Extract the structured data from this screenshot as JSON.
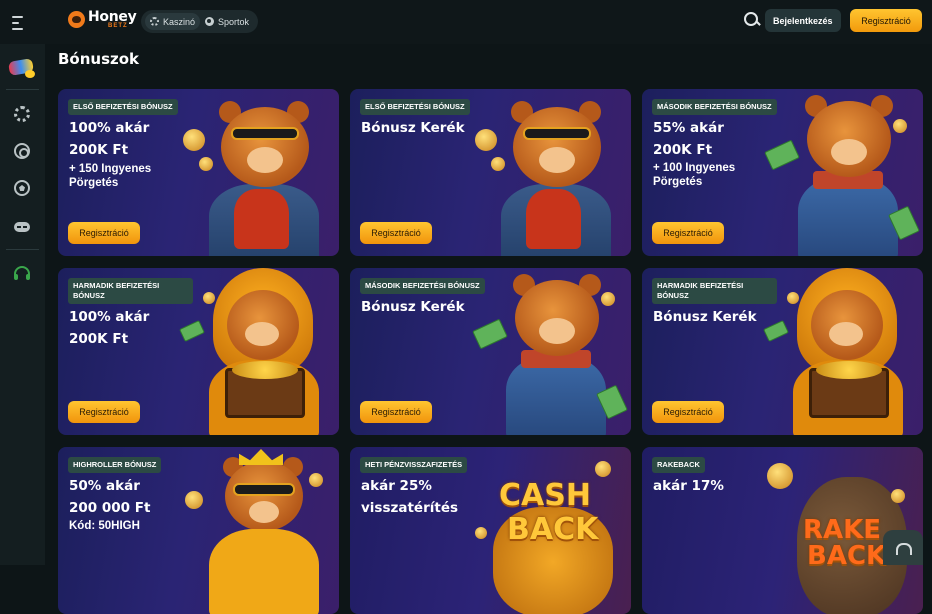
{
  "header": {
    "logo_main": "Honey",
    "logo_sub": "BETZ",
    "modes": [
      {
        "label": "Kaszinó",
        "icon": "chip-icon"
      },
      {
        "label": "Sportok",
        "icon": "ball-icon"
      }
    ],
    "login_label": "Bejelentkezés",
    "register_label": "Regisztráció",
    "accent_color": "#f5a623"
  },
  "sidebar": {
    "items": [
      {
        "icon": "promo-icon"
      },
      {
        "icon": "casino-chip-icon"
      },
      {
        "icon": "live-casino-icon"
      },
      {
        "icon": "sports-ball-icon"
      },
      {
        "icon": "gamepad-icon"
      },
      {
        "icon": "support-headset-icon"
      }
    ]
  },
  "page": {
    "title": "Bónuszok"
  },
  "cards": [
    {
      "badge": "ELSŐ BEFIZETÉSI BÓNUSZ",
      "title": "100% akár\n  200K Ft",
      "sub": "+ 150 Ingyenes Pörgetés",
      "cta": "Regisztráció"
    },
    {
      "badge": "ELSŐ BEFIZETÉSI BÓNUSZ",
      "title": "Bónusz Kerék",
      "sub": "",
      "cta": "Regisztráció"
    },
    {
      "badge": "MÁSODIK BEFIZETÉSI BÓNUSZ",
      "title": "55% akár\n200K Ft",
      "sub": "+ 100 Ingyenes Pörgetés",
      "cta": "Regisztráció"
    },
    {
      "badge": "HARMADIK BEFIZETÉSI BÓNUSZ",
      "title": "100% akár\n200K Ft",
      "sub": "",
      "cta": "Regisztráció"
    },
    {
      "badge": "MÁSODIK BEFIZETÉSI BÓNUSZ",
      "title": "Bónusz Kerék",
      "sub": "",
      "cta": "Regisztráció"
    },
    {
      "badge": "HARMADIK BEFIZETÉSI BÓNUSZ",
      "title": "Bónusz Kerék",
      "sub": "",
      "cta": "Regisztráció"
    },
    {
      "badge": "HIGHROLLER BÓNUSZ",
      "title": "50% akár\n200 000 Ft",
      "sub": "Kód: 50HIGH",
      "cta": ""
    },
    {
      "badge": "HETI PÉNZVISSZAFIZETÉS",
      "title": "akár 25%\nvisszatérítés",
      "sub": "",
      "cta": "",
      "art_text": [
        "CASH",
        "BACK"
      ]
    },
    {
      "badge": "RAKEBACK",
      "title": "akár 17%",
      "sub": "",
      "cta": "",
      "art_text": [
        "RAKE",
        "BACK"
      ]
    }
  ],
  "support_button": {
    "icon": "headset-icon"
  }
}
